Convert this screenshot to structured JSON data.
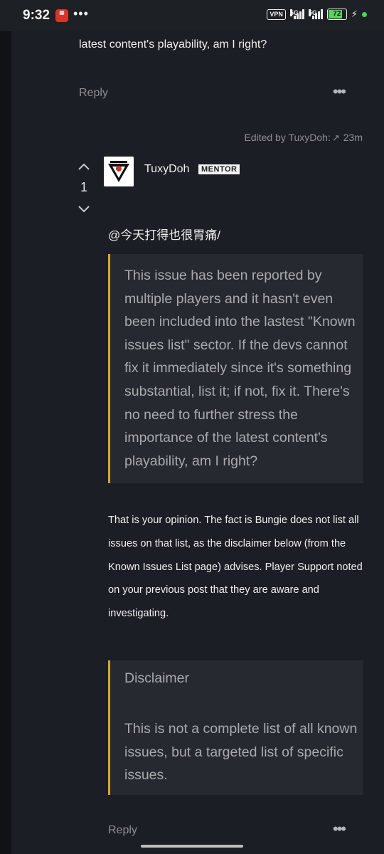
{
  "status_bar": {
    "time": "9:32",
    "dots": "•••",
    "vpn": "VPN",
    "net1": "5G",
    "net2": "5G",
    "battery": "72"
  },
  "prev_post": {
    "tail_text": "latest content's playability, am I right?",
    "reply_label": "Reply",
    "more_label": "•••"
  },
  "post": {
    "edited_text": "Edited by TuxyDoh:",
    "time_ago": "23m",
    "vote_count": "1",
    "username": "TuxyDoh",
    "badge": "MENTOR",
    "mention": "@今天打得也很胃痛/",
    "quote_text": "This issue has been reported by multiple players and it hasn't even been included into the lastest \"Known issues list\" sector. If the devs cannot fix it immediately since it's something substantial, list it; if not, fix it. There's no need to further stress the importance of the latest content's playability, am I right?",
    "body": "That is your opinion. The fact is Bungie does not list all issues on that list, as the disclaimer below (from the Known Issues List page) advises. Player Support noted on your previous post that they are aware and investigating.",
    "disclaimer_title": "Disclaimer",
    "disclaimer_text": "This is not a complete list of all known issues, but a targeted list of specific issues.",
    "reply_label": "Reply",
    "more_label": "•••"
  }
}
